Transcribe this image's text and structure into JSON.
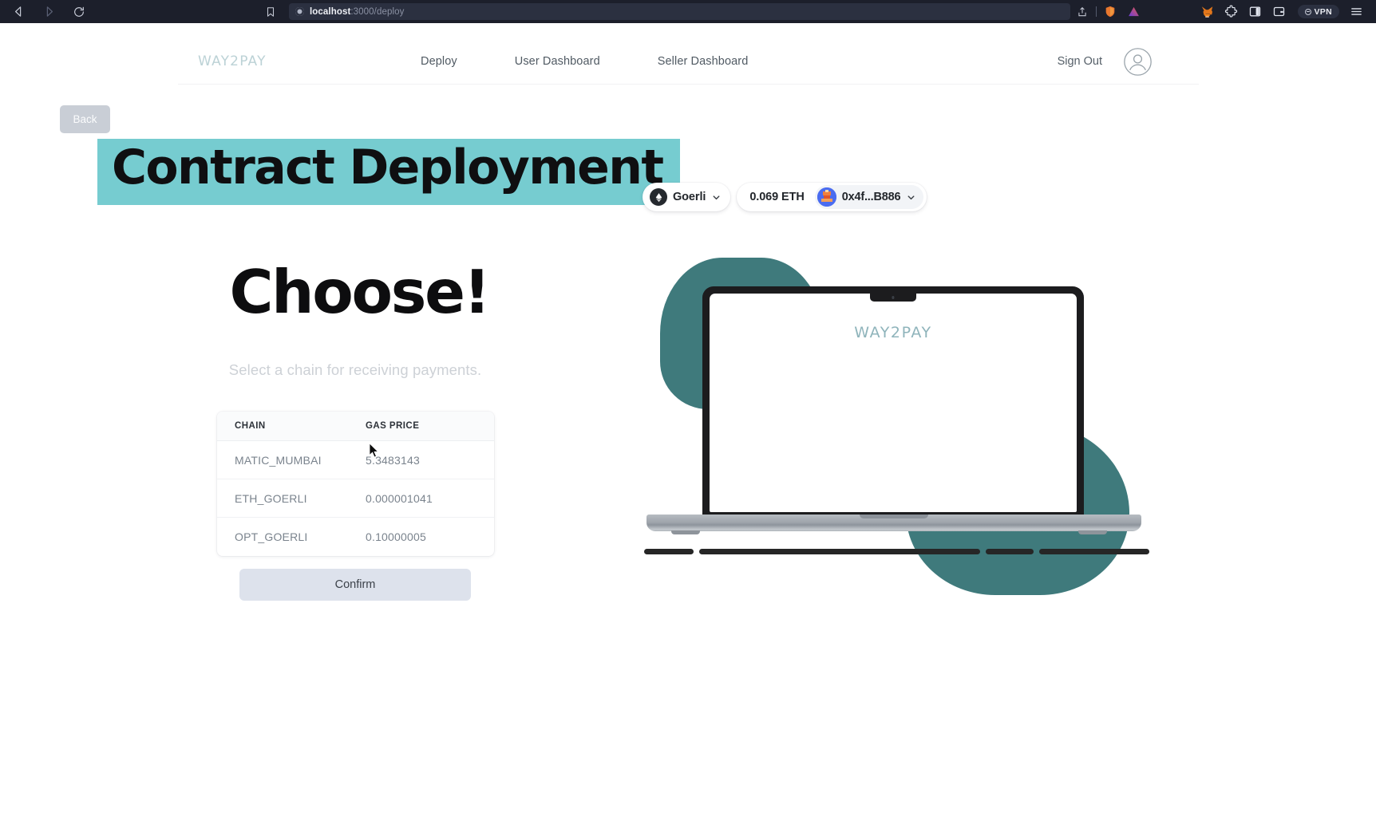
{
  "browser": {
    "back_icon": "back-arrow-icon",
    "forward_icon": "forward-arrow-icon",
    "reload_icon": "reload-icon",
    "bookmark_icon": "bookmark-icon",
    "site_info_icon": "site-info-icon",
    "url_host": "localhost",
    "url_path": ":3000/deploy",
    "share_icon": "share-icon",
    "brave_shields_icon": "brave-shields-icon",
    "brave_rewards_icon": "brave-rewards-icon",
    "metamask_icon": "metamask-fox-icon",
    "extensions_icon": "extensions-puzzle-icon",
    "sidebar_icon": "sidebar-panel-icon",
    "wallet_icon": "brave-wallet-icon",
    "vpn_label": "VPN",
    "menu_icon": "hamburger-menu-icon"
  },
  "nav": {
    "brand": "WAY2PAY",
    "links": [
      {
        "label": "Deploy"
      },
      {
        "label": "User Dashboard"
      },
      {
        "label": "Seller Dashboard"
      }
    ],
    "signout_label": "Sign Out",
    "avatar_icon": "user-avatar-icon"
  },
  "main": {
    "back_label": "Back",
    "page_title": "Contract Deployment",
    "heading": "Choose!",
    "subheading": "Select a chain for receiving payments.",
    "confirm_label": "Confirm"
  },
  "chain_table": {
    "columns": [
      "CHAIN",
      "GAS PRICE"
    ],
    "rows": [
      {
        "chain": "MATIC_MUMBAI",
        "gas_price": "5.3483143"
      },
      {
        "chain": "ETH_GOERLI",
        "gas_price": "0.000001041"
      },
      {
        "chain": "OPT_GOERLI",
        "gas_price": "0.10000005"
      }
    ]
  },
  "wallet": {
    "network_icon": "ethereum-diamond-icon",
    "network": "Goerli",
    "network_chevron_icon": "chevron-down-icon",
    "balance": "0.069 ETH",
    "account_avatar_icon": "account-blockie-icon",
    "address": "0x4f...B886",
    "account_chevron_icon": "chevron-down-icon"
  },
  "illustration": {
    "screen_brand": "WAY2PAY",
    "blob_color": "#3f7a7c",
    "highlight_color": "#76ccd0"
  }
}
